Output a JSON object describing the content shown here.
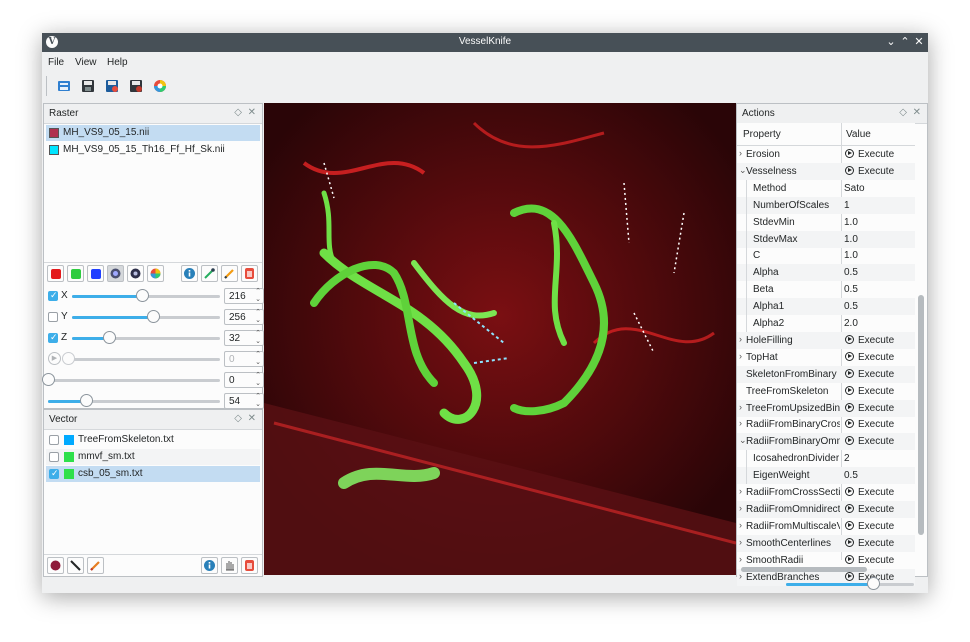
{
  "window": {
    "title": "VesselKnife",
    "app_icon": "V"
  },
  "menu": [
    "File",
    "View",
    "Help"
  ],
  "toolbar_icons": [
    "open-icon",
    "save-icon",
    "save-as-icon",
    "save-all-icon",
    "color-wheel-icon"
  ],
  "raster": {
    "title": "Raster",
    "items": [
      {
        "name": "MH_VS9_05_15.nii",
        "color": "#b03050",
        "selected": true
      },
      {
        "name": "MH_VS9_05_15_Th16_Ff_Hf_Sk.nii",
        "color": "#00e5ff",
        "selected": false
      }
    ],
    "tool_colors": [
      "#e31a1c",
      "#2ecc40",
      "#1f3fff"
    ],
    "sliders": [
      {
        "label": "X",
        "checked": true,
        "value": "216",
        "fraction": 0.47
      },
      {
        "label": "Y",
        "checked": false,
        "value": "256",
        "fraction": 0.55
      },
      {
        "label": "Z",
        "checked": true,
        "value": "32",
        "fraction": 0.25
      },
      {
        "label": "",
        "checked": false,
        "value": "0",
        "fraction": 0.0,
        "disabled": true
      },
      {
        "label": "",
        "checked": false,
        "value": "0",
        "fraction": 0.0
      },
      {
        "label": "",
        "checked": false,
        "value": "54",
        "fraction": 0.22
      }
    ]
  },
  "vector": {
    "title": "Vector",
    "items": [
      {
        "name": "TreeFromSkeleton.txt",
        "color": "#00aaff",
        "checked": false,
        "selected": false
      },
      {
        "name": "mmvf_sm.txt",
        "color": "#2ee04a",
        "checked": false,
        "selected": false
      },
      {
        "name": "csb_05_sm.txt",
        "color": "#2ee04a",
        "checked": true,
        "selected": true
      }
    ]
  },
  "actions": {
    "title": "Actions",
    "header": {
      "property": "Property",
      "value": "Value"
    },
    "execute_label": "Execute",
    "rows": [
      {
        "k": "Erosion",
        "type": "exec",
        "chev": "›",
        "indent": 0
      },
      {
        "k": "Vesselness",
        "type": "exec",
        "chev": "⌄",
        "indent": 0
      },
      {
        "k": "Method",
        "type": "val",
        "v": "Sato",
        "indent": 1
      },
      {
        "k": "NumberOfScales",
        "type": "val",
        "v": "1",
        "indent": 1
      },
      {
        "k": "StdevMin",
        "type": "val",
        "v": "1.0",
        "indent": 1
      },
      {
        "k": "StdevMax",
        "type": "val",
        "v": "1.0",
        "indent": 1
      },
      {
        "k": "C",
        "type": "val",
        "v": "1.0",
        "indent": 1
      },
      {
        "k": "Alpha",
        "type": "val",
        "v": "0.5",
        "indent": 1
      },
      {
        "k": "Beta",
        "type": "val",
        "v": "0.5",
        "indent": 1
      },
      {
        "k": "Alpha1",
        "type": "val",
        "v": "0.5",
        "indent": 1
      },
      {
        "k": "Alpha2",
        "type": "val",
        "v": "2.0",
        "indent": 1
      },
      {
        "k": "HoleFilling",
        "type": "exec",
        "chev": "›",
        "indent": 0
      },
      {
        "k": "TopHat",
        "type": "exec",
        "chev": "›",
        "indent": 0
      },
      {
        "k": "SkeletonFromBinary",
        "type": "exec",
        "chev": "",
        "indent": 0
      },
      {
        "k": "TreeFromSkeleton",
        "type": "exec",
        "chev": "",
        "indent": 0
      },
      {
        "k": "TreeFromUpsizedBinary",
        "type": "exec",
        "chev": "›",
        "indent": 0
      },
      {
        "k": "RadiiFromBinaryCross...",
        "type": "exec",
        "chev": "›",
        "indent": 0
      },
      {
        "k": "RadiiFromBinaryOmni...",
        "type": "exec",
        "chev": "⌄",
        "indent": 0
      },
      {
        "k": "IcosahedronDivider",
        "type": "val",
        "v": "2",
        "indent": 1
      },
      {
        "k": "EigenWeight",
        "type": "val",
        "v": "0.5",
        "indent": 1
      },
      {
        "k": "RadiiFromCrossSectio...",
        "type": "exec",
        "chev": "›",
        "indent": 0
      },
      {
        "k": "RadiiFromOmnidirecti...",
        "type": "exec",
        "chev": "›",
        "indent": 0
      },
      {
        "k": "RadiiFromMultiscaleV...",
        "type": "exec",
        "chev": "›",
        "indent": 0
      },
      {
        "k": "SmoothCenterlines",
        "type": "exec",
        "chev": "›",
        "indent": 0
      },
      {
        "k": "SmoothRadii",
        "type": "exec",
        "chev": "›",
        "indent": 0
      },
      {
        "k": "ExtendBranches",
        "type": "exec",
        "chev": "›",
        "indent": 0
      }
    ]
  },
  "zoom_fraction": 0.68
}
